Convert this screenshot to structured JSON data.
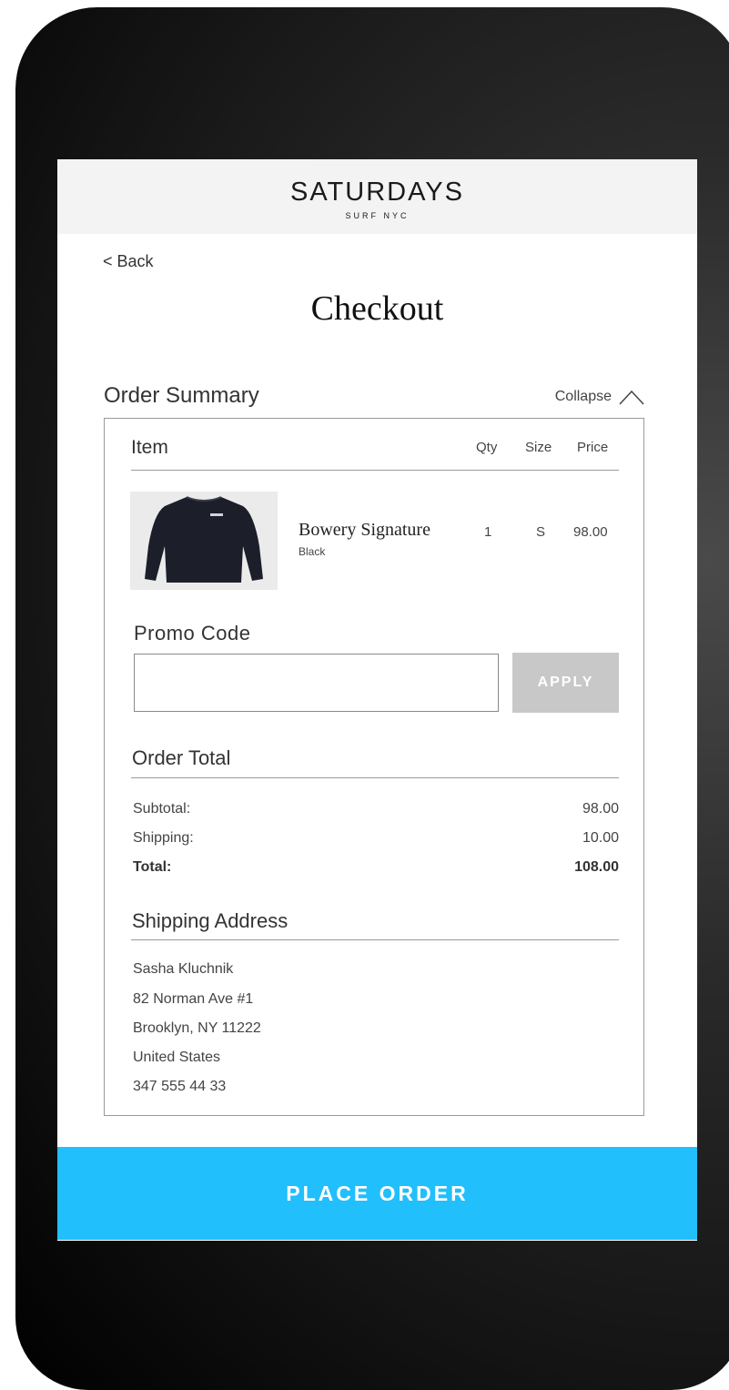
{
  "header": {
    "brand": "SATURDAYS",
    "brand_sub": "SURF NYC"
  },
  "nav": {
    "back_label": "< Back"
  },
  "page": {
    "title": "Checkout"
  },
  "order_summary": {
    "title": "Order Summary",
    "collapse_label": "Collapse",
    "columns": {
      "item": "Item",
      "qty": "Qty",
      "size": "Size",
      "price": "Price"
    },
    "items": [
      {
        "name": "Bowery Signature",
        "variant": "Black",
        "qty": "1",
        "size": "S",
        "price": "98.00"
      }
    ]
  },
  "promo": {
    "label": "Promo Code",
    "value": "",
    "placeholder": "",
    "apply_label": "APPLY"
  },
  "order_total": {
    "title": "Order Total",
    "subtotal_label": "Subtotal:",
    "subtotal_value": "98.00",
    "shipping_label": "Shipping:",
    "shipping_value": "10.00",
    "total_label": "Total:",
    "total_value": "108.00"
  },
  "shipping_address": {
    "title": "Shipping Address",
    "lines": [
      "Sasha Kluchnik",
      "82 Norman Ave #1",
      "Brooklyn, NY 11222",
      "United States",
      "347 555 44 33"
    ]
  },
  "cta": {
    "place_order_label": "PLACE ORDER"
  },
  "colors": {
    "accent": "#21bffb",
    "apply_button": "#c8c8c8",
    "header_bg": "#f3f3f3"
  }
}
